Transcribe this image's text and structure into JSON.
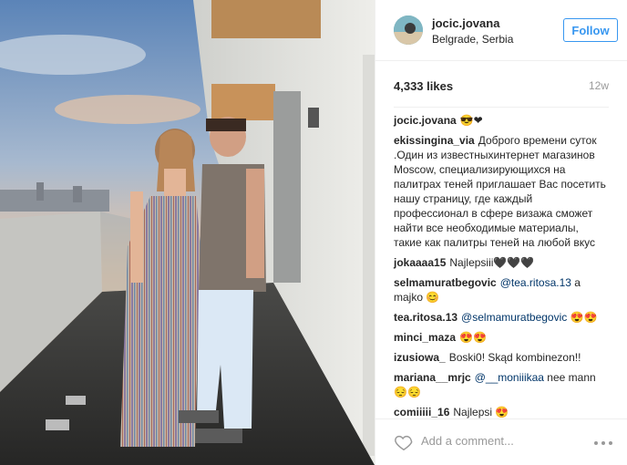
{
  "post": {
    "username": "jocic.jovana",
    "location": "Belgrade, Serbia",
    "follow_label": "Follow",
    "likes": "4,333 likes",
    "age": "12w",
    "caption_user": "jocic.jovana",
    "caption_text": "😎❤"
  },
  "comments": [
    {
      "user": "ekissingina_via",
      "text": "Доброго времени суток .Один из известныхинтернет магазинов Moscow, специализирующихся на палитрах теней приглашает Вас посетить нашу страницу, где каждый профессионал в сфере визажа сможет найти все необходимые материалы, такие как палитры теней на любой вкус"
    },
    {
      "user": "jokaaaa15",
      "text": "Najlepsiii🖤🖤🖤"
    },
    {
      "user": "selmamuratbegovic",
      "mention": "@tea.ritosa.13",
      "text": "a majko 😊"
    },
    {
      "user": "tea.ritosa.13",
      "mention": "@selmamuratbegovic",
      "text": "😍😍"
    },
    {
      "user": "minci_maza",
      "text": "😍😍"
    },
    {
      "user": "izusiowa_",
      "text": "Boski0! Skąd kombinezon!!"
    },
    {
      "user": "mariana__mrjc",
      "mention": "@__moniiikaa",
      "text": "nee mann 😔😔"
    },
    {
      "user": "comiiiii_16",
      "text": "Najlepsi 😍"
    }
  ],
  "composer": {
    "placeholder": "Add a comment..."
  },
  "icons": {
    "heart": "heart-icon",
    "more": "more-options-icon"
  }
}
